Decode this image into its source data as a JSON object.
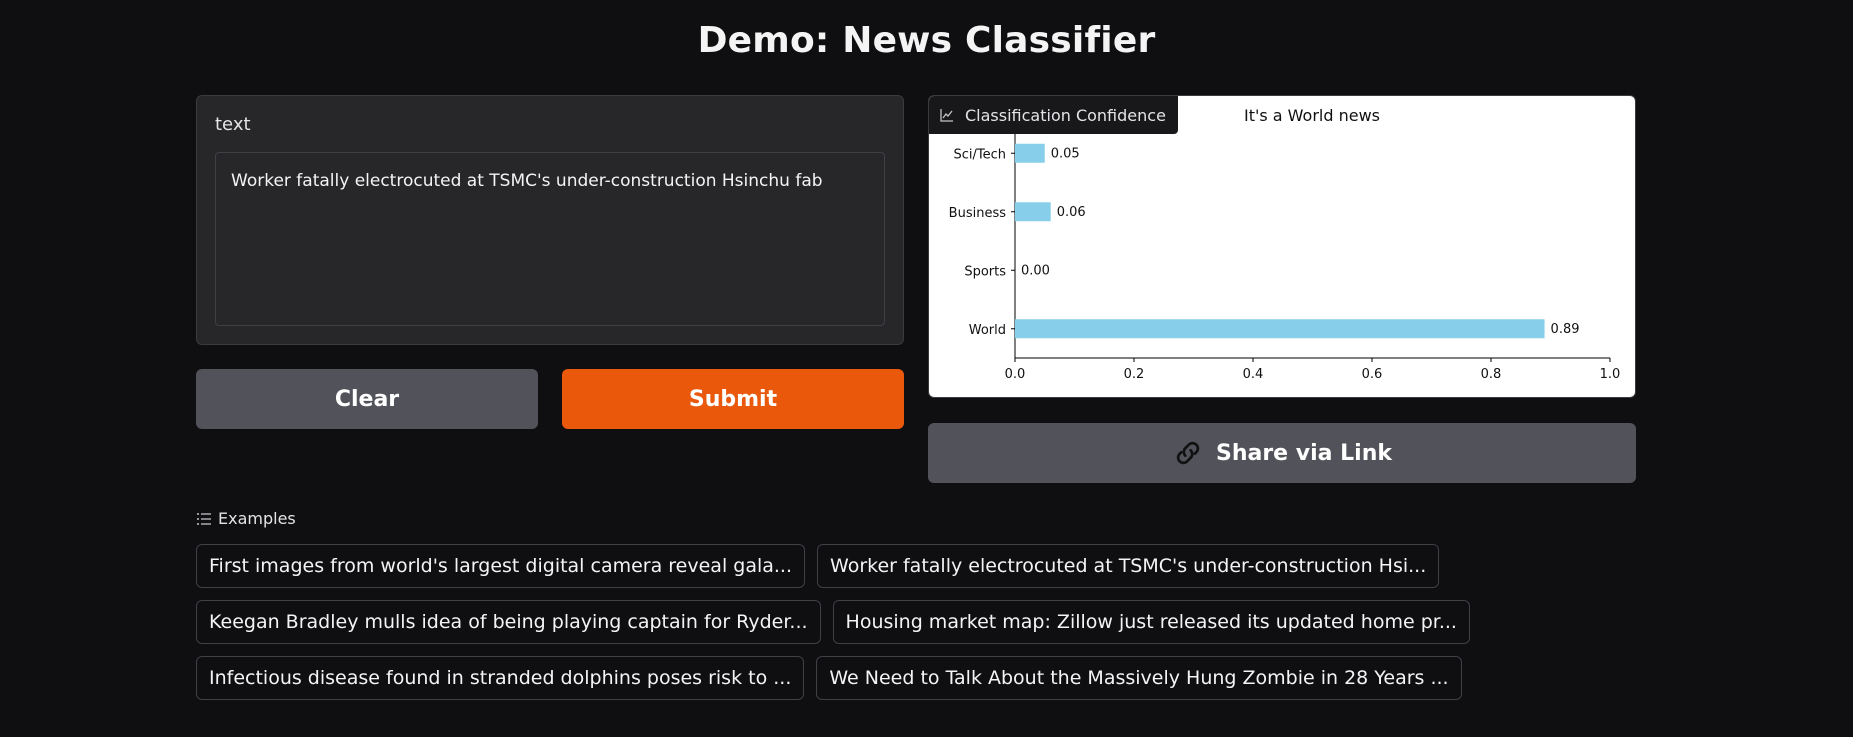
{
  "page": {
    "title": "Demo: News Classifier"
  },
  "input": {
    "label": "text",
    "value": "Worker fatally electrocuted at TSMC's under-construction Hsinchu fab"
  },
  "buttons": {
    "clear": "Clear",
    "submit": "Submit",
    "share": "Share via Link"
  },
  "output": {
    "tag_label": "Classification Confidence"
  },
  "chart_data": {
    "type": "bar",
    "orientation": "horizontal",
    "title": "It's a World news",
    "categories": [
      "World",
      "Sports",
      "Business",
      "Sci/Tech"
    ],
    "values": [
      0.89,
      0.0,
      0.06,
      0.05
    ],
    "value_labels": [
      "0.89",
      "0.00",
      "0.06",
      "0.05"
    ],
    "xlim": [
      0.0,
      1.0
    ],
    "xticks": [
      "0.0",
      "0.2",
      "0.4",
      "0.6",
      "0.8",
      "1.0"
    ],
    "bar_color": "#87ceeb",
    "grid": false
  },
  "examples": {
    "header": "Examples",
    "rows": [
      [
        "First images from world's largest digital camera reveal gala...",
        "Worker fatally electrocuted at TSMC's under-construction Hsi..."
      ],
      [
        "Keegan Bradley mulls idea of being playing captain for Ryder...",
        "Housing market map: Zillow just released its updated home pr..."
      ],
      [
        "Infectious disease found in stranded dolphins poses risk to ...",
        "We Need to Talk About the Massively Hung Zombie in 28 Years ..."
      ]
    ]
  },
  "colors": {
    "background": "#0f0f11",
    "accent": "#ea580c",
    "secondary_button": "#52525b"
  }
}
